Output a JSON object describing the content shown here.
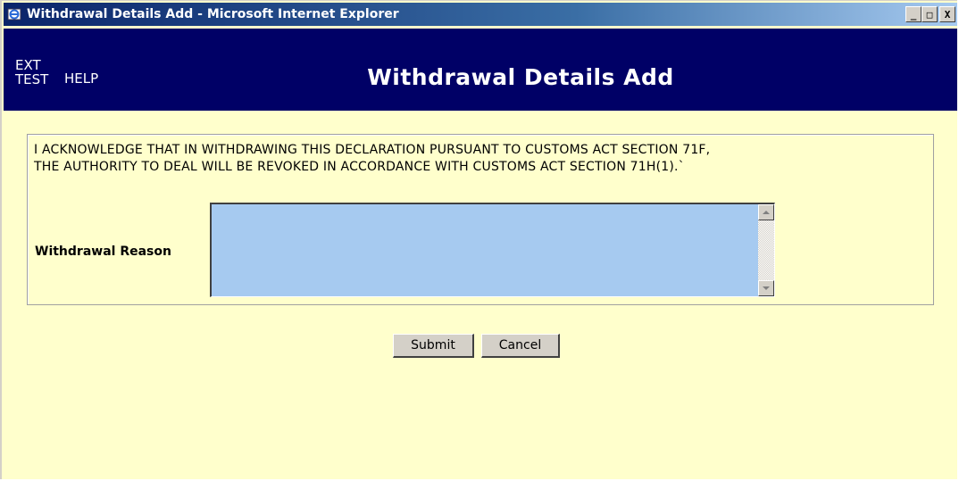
{
  "window": {
    "title": "Withdrawal Details Add - Microsoft Internet Explorer",
    "minimize_glyph": "_",
    "maximize_glyph": "□",
    "close_glyph": "X"
  },
  "header": {
    "env_line1": "EXT",
    "env_line2": "TEST",
    "help_label": "HELP",
    "title": "Withdrawal Details Add",
    "background_color": "#000066"
  },
  "form": {
    "acknowledgement": "I ACKNOWLEDGE THAT IN WITHDRAWING THIS DECLARATION PURSUANT TO CUSTOMS ACT SECTION 71F,\nTHE AUTHORITY TO DEAL WILL BE REVOKED IN ACCORDANCE WITH CUSTOMS ACT SECTION 71H(1).`",
    "reason_label": "Withdrawal Reason",
    "reason_value": "",
    "field_color": "#a6caf0"
  },
  "actions": {
    "submit_label": "Submit",
    "cancel_label": "Cancel"
  },
  "colors": {
    "page_background": "#ffffcc"
  }
}
